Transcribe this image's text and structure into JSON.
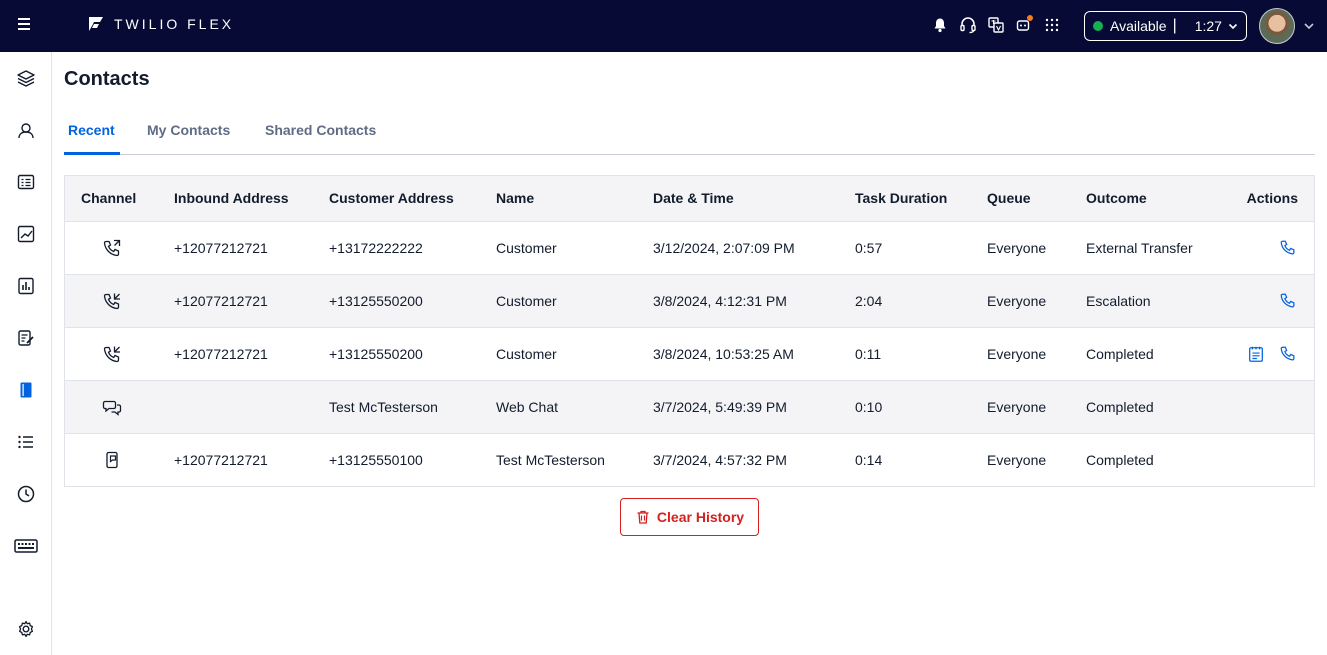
{
  "app": {
    "brand": "TWILIO FLEX"
  },
  "status": {
    "label": "Available",
    "separator": "|",
    "timer": "1:27"
  },
  "page": {
    "title": "Contacts"
  },
  "tabs": [
    {
      "label": "Recent"
    },
    {
      "label": "My Contacts"
    },
    {
      "label": "Shared Contacts"
    }
  ],
  "table": {
    "headers": {
      "channel": "Channel",
      "inbound": "Inbound Address",
      "customer": "Customer Address",
      "name": "Name",
      "datetime": "Date & Time",
      "duration": "Task Duration",
      "queue": "Queue",
      "outcome": "Outcome",
      "actions": "Actions"
    },
    "rows": [
      {
        "channel": "outbound-call",
        "inbound": "+12077212721",
        "customer": "+13172222222",
        "name": "Customer",
        "datetime": "3/12/2024, 2:07:09 PM",
        "duration": "0:57",
        "queue": "Everyone",
        "outcome": "External Transfer",
        "actions": [
          "call"
        ]
      },
      {
        "channel": "inbound-call",
        "inbound": "+12077212721",
        "customer": "+13125550200",
        "name": "Customer",
        "datetime": "3/8/2024, 4:12:31 PM",
        "duration": "2:04",
        "queue": "Everyone",
        "outcome": "Escalation",
        "actions": [
          "call"
        ]
      },
      {
        "channel": "inbound-call",
        "inbound": "+12077212721",
        "customer": "+13125550200",
        "name": "Customer",
        "datetime": "3/8/2024, 10:53:25 AM",
        "duration": "0:11",
        "queue": "Everyone",
        "outcome": "Completed",
        "actions": [
          "notes",
          "call"
        ]
      },
      {
        "channel": "web-chat",
        "inbound": "",
        "customer": "Test McTesterson",
        "name": "Web Chat",
        "datetime": "3/7/2024, 5:49:39 PM",
        "duration": "0:10",
        "queue": "Everyone",
        "outcome": "Completed",
        "actions": []
      },
      {
        "channel": "sms",
        "inbound": "+12077212721",
        "customer": "+13125550100",
        "name": "Test McTesterson",
        "datetime": "3/7/2024, 4:57:32 PM",
        "duration": "0:14",
        "queue": "Everyone",
        "outcome": "Completed",
        "actions": []
      }
    ]
  },
  "clear_history": {
    "label": "Clear History"
  },
  "colors": {
    "topbar": "#060a35",
    "accent": "#0263e0",
    "danger": "#d61f1f",
    "available": "#14b053"
  }
}
